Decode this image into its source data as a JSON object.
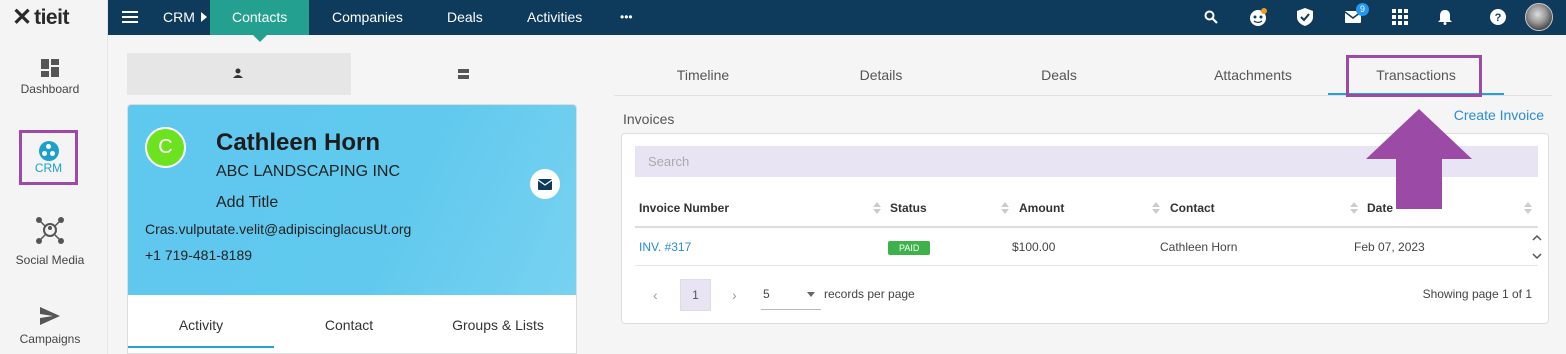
{
  "app": {
    "logo_text": "tieit"
  },
  "rail": {
    "items": [
      {
        "label": "Dashboard",
        "icon": "dashboard-icon"
      },
      {
        "label": "CRM",
        "icon": "crm-icon"
      },
      {
        "label": "Social Media",
        "icon": "social-media-icon"
      },
      {
        "label": "Campaigns",
        "icon": "send-icon"
      }
    ]
  },
  "topbar": {
    "module": "CRM",
    "tabs": [
      "Contacts",
      "Companies",
      "Deals",
      "Activities"
    ],
    "more": "•••",
    "mail_badge": "9"
  },
  "contact": {
    "initial": "C",
    "name": "Cathleen Horn",
    "company": "ABC LANDSCAPING INC",
    "title": "Add Title",
    "email": "Cras.vulputate.velit@adipiscinglacusUt.org",
    "phone": "+1 719-481-8189",
    "tabs": [
      "Activity",
      "Contact",
      "Groups & Lists"
    ]
  },
  "detail_tabs": [
    "Timeline",
    "Details",
    "Deals",
    "Attachments",
    "Transactions"
  ],
  "invoices": {
    "section_label": "Invoices",
    "create_label": "Create Invoice",
    "search_placeholder": "Search",
    "columns": [
      "Invoice Number",
      "Status",
      "Amount",
      "Contact",
      "Date"
    ],
    "rows": [
      {
        "number": "INV. #317",
        "status": "PAID",
        "amount": "$100.00",
        "contact": "Cathleen Horn",
        "date": "Feb 07, 2023"
      }
    ],
    "pager": {
      "current_page": "1",
      "page_size": "5",
      "page_size_label": "records per page",
      "showing": "Showing page 1 of 1"
    }
  },
  "colors": {
    "topbar": "#0e3a5c",
    "active_tab": "#23a08f",
    "card_header": "#5fc8ef",
    "accent_link": "#2a8cd6",
    "annotation": "#9b4aa6",
    "paid": "#3eb24a"
  }
}
